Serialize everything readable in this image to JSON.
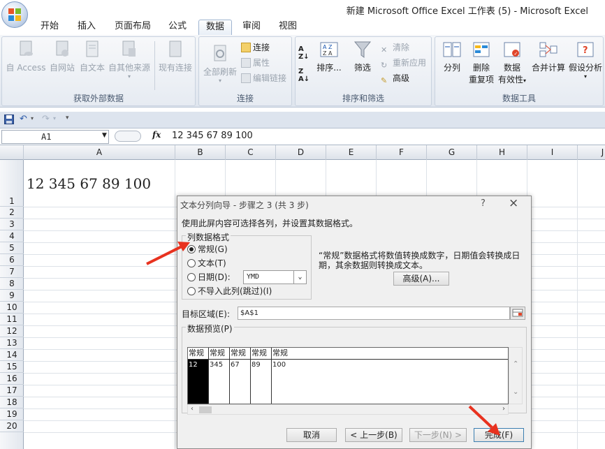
{
  "window": {
    "title": "新建 Microsoft Office Excel 工作表 (5) - Microsoft Excel"
  },
  "ribbon_tabs": [
    "开始",
    "插入",
    "页面布局",
    "公式",
    "数据",
    "审阅",
    "视图"
  ],
  "active_tab": "数据",
  "groups": {
    "external": {
      "title": "获取外部数据",
      "buttons": [
        "自 Access",
        "自网站",
        "自文本",
        "自其他来源",
        "现有连接"
      ]
    },
    "connections": {
      "title": "连接",
      "refresh": "全部刷新",
      "items": [
        "连接",
        "属性",
        "编辑链接"
      ]
    },
    "sort_filter": {
      "title": "排序和筛选",
      "sort": "排序...",
      "filter": "筛选",
      "items": [
        "清除",
        "重新应用",
        "高级"
      ]
    },
    "data_tools": {
      "title": "数据工具",
      "split": "分列",
      "dedupe": [
        "删除",
        "重复项"
      ],
      "validation": [
        "数据",
        "有效性"
      ],
      "consolidate": "合并计算",
      "whatif": "假设分析"
    }
  },
  "formula_bar": {
    "name_box": "A1",
    "fx": "fx",
    "content": "12 345 67 89 100"
  },
  "columns": [
    "A",
    "B",
    "C",
    "D",
    "E",
    "F",
    "G",
    "H",
    "I",
    "J"
  ],
  "rows": [
    "1",
    "2",
    "3",
    "4",
    "5",
    "6",
    "7",
    "8",
    "9",
    "10",
    "11",
    "12",
    "13",
    "14",
    "15",
    "16",
    "17",
    "18",
    "19",
    "20"
  ],
  "cell_a1": "12 345 67 89 100",
  "dialog": {
    "title": "文本分列向导 - 步骤之 3 (共 3 步)",
    "help": "?",
    "close": "×",
    "description": "使用此屏内容可选择各列，并设置其数据格式。",
    "format_legend": "列数据格式",
    "options": [
      "常规(G)",
      "文本(T)",
      "日期(D):",
      "不导入此列(跳过)(I)"
    ],
    "selected_option": 0,
    "date_format": "YMD",
    "hint": "“常规”数据格式将数值转换成数字，日期值会转换成日期，其余数据则转换成文本。",
    "advanced": "高级(A)...",
    "destination_label": "目标区域(E):",
    "destination_value": "$A$1",
    "preview_legend": "数据预览(P)",
    "preview_headers": [
      "常规",
      "常规",
      "常规",
      "常规",
      "常规"
    ],
    "preview_values": [
      "12",
      "345",
      "67",
      "89",
      "100"
    ],
    "buttons": {
      "cancel": "取消",
      "back": "< 上一步(B)",
      "next": "下一步(N) >",
      "finish": "完成(F)"
    }
  },
  "colors": {
    "annotation_arrow": "#e8321f",
    "accent": "#3c7fb1"
  }
}
